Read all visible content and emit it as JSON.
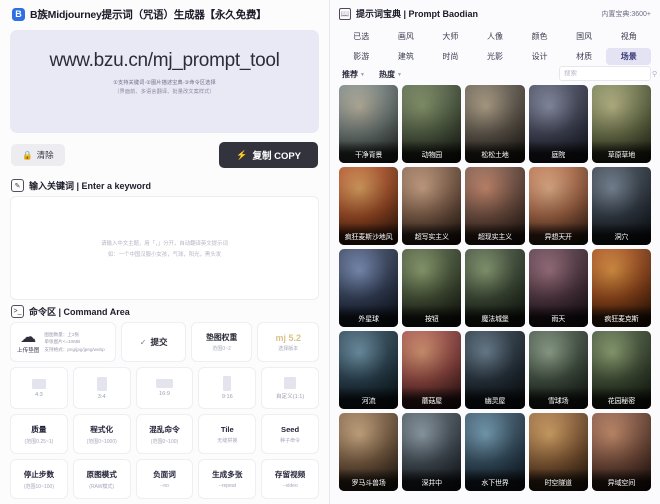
{
  "left": {
    "titlebar": {
      "logo": "B",
      "title": "B族Midjourney提示词（咒语）生成器【永久免费】"
    },
    "hero": {
      "url": "www.bzu.cn/mj_prompt_tool",
      "sub1": "①支持关键词·②图片描述宝典·③命令区选择",
      "sub2": "（界面前、多语言翻译、批量改文案样式）"
    },
    "actions": {
      "clear_label": "清除",
      "clear_icon": "lock-icon",
      "copy_label": "复制 COPY",
      "copy_icon": "lightning-icon"
    },
    "keyword_section": {
      "icon": "note-edit-icon",
      "heading": "输入关键词 | Enter a keyword",
      "placeholder_line1": "请输入中文主题，用「，」分开，自动翻译英文提示词",
      "placeholder_line2": "如：一个中国汉服小女孩，气球，阳光，黑头发"
    },
    "command_section": {
      "icon": "terminal-icon",
      "heading": "命令区 | Command Area",
      "upload": {
        "icon": "cloud-upload-icon",
        "label": "上传垫图",
        "meta": [
          "图图数量：上2张",
          "单张图片<=10MB",
          "支持格式：png/jpg/jpeg/webp"
        ]
      },
      "submit": {
        "icon": "check-circle-icon",
        "label": "提交"
      },
      "weight": {
        "label": "垫图权重",
        "sub": "范围0~2"
      },
      "version": {
        "label": "mj 5.2",
        "sub": "选择版本"
      },
      "ratios": [
        {
          "label": "4:3",
          "w": 14,
          "h": 10
        },
        {
          "label": "3:4",
          "w": 10,
          "h": 14
        },
        {
          "label": "16:9",
          "w": 17,
          "h": 9
        },
        {
          "label": "9:16",
          "w": 8,
          "h": 15
        },
        {
          "label": "自定义(1:1)",
          "w": 12,
          "h": 12
        }
      ],
      "params": [
        {
          "name": "质量",
          "sub": "(范围0.25~1)"
        },
        {
          "name": "程式化",
          "sub": "(范围0~1000)"
        },
        {
          "name": "混乱命令",
          "sub": "(范围0~100)"
        },
        {
          "name": "Tile",
          "sub": "无缝拼接"
        },
        {
          "name": "Seed",
          "sub": "种子命令"
        },
        {
          "name": "停止步数",
          "sub": "(范围10~100)"
        },
        {
          "name": "原图模式",
          "sub": "(RAW模式)"
        },
        {
          "name": "负面词",
          "sub": "--no"
        },
        {
          "name": "生成多张",
          "sub": "--repeat"
        },
        {
          "name": "存留视频",
          "sub": "--video"
        }
      ]
    }
  },
  "right": {
    "header": {
      "icon": "book-icon",
      "title": "提示词宝典 | Prompt Baodian",
      "count": "内置宝典:3600+"
    },
    "categories_row1": [
      "已选",
      "画风",
      "大师",
      "人像",
      "颜色",
      "国风",
      "视角"
    ],
    "categories_row2": [
      "影游",
      "建筑",
      "时尚",
      "光影",
      "设计",
      "材质",
      "场景"
    ],
    "active_category": "场景",
    "sort": {
      "recommend": "推荐",
      "hot": "热度",
      "caret": "chevron-down-icon"
    },
    "search": {
      "placeholder": "搜索",
      "icon": "search-icon"
    },
    "thumbs": [
      {
        "label": "干净背景",
        "c1": "#7d8a86",
        "c2": "#2b3230",
        "c3": "#c2b9a4"
      },
      {
        "label": "动物园",
        "c1": "#5c6b4e",
        "c2": "#1d2318",
        "c3": "#8a9a6a"
      },
      {
        "label": "松松土地",
        "c1": "#6d6457",
        "c2": "#241f1a",
        "c3": "#b9a98c"
      },
      {
        "label": "庭院",
        "c1": "#4a4e63",
        "c2": "#181b28",
        "c3": "#8e93ad"
      },
      {
        "label": "草原草地",
        "c1": "#7d8457",
        "c2": "#2a2e1c",
        "c3": "#c3c08a"
      },
      {
        "label": "疯狂麦斯沙地风",
        "c1": "#b2552a",
        "c2": "#3a1a0c",
        "c3": "#e4a35c"
      },
      {
        "label": "超写实主义",
        "c1": "#8f6a52",
        "c2": "#2c1d15",
        "c3": "#d4a887"
      },
      {
        "label": "超现实主义",
        "c1": "#7f5a4a",
        "c2": "#2a1a14",
        "c3": "#d08a6c"
      },
      {
        "label": "异想天开",
        "c1": "#b9734f",
        "c2": "#3b2014",
        "c3": "#edb489"
      },
      {
        "label": "洞穴",
        "c1": "#3a4450",
        "c2": "#10151c",
        "c3": "#7b8a9c"
      },
      {
        "label": "外星球",
        "c1": "#3c4a66",
        "c2": "#101726",
        "c3": "#7d93c0"
      },
      {
        "label": "按钮",
        "c1": "#4e5c3e",
        "c2": "#161d12",
        "c3": "#8fa46e"
      },
      {
        "label": "魔法城堡",
        "c1": "#46543e",
        "c2": "#141a12",
        "c3": "#8aa071"
      },
      {
        "label": "雨天",
        "c1": "#5b3e4a",
        "c2": "#1c1218",
        "c3": "#a0707f"
      },
      {
        "label": "疯狂麦克斯",
        "c1": "#a8521f",
        "c2": "#36180a",
        "c3": "#e6953c"
      },
      {
        "label": "河流",
        "c1": "#2f4a5a",
        "c2": "#0d1820",
        "c3": "#6e97ad"
      },
      {
        "label": "蘑菇屋",
        "c1": "#a6524a",
        "c2": "#35161a",
        "c3": "#e09a72"
      },
      {
        "label": "幽灵屋",
        "c1": "#2c3a46",
        "c2": "#0c1116",
        "c3": "#6b8294"
      },
      {
        "label": "雪球场",
        "c1": "#4a5a4a",
        "c2": "#161e18",
        "c3": "#93a88f"
      },
      {
        "label": "花园秘密",
        "c1": "#4a5a3e",
        "c2": "#171f14",
        "c3": "#8fa672"
      },
      {
        "label": "罗马斗兽场",
        "c1": "#8a6a4c",
        "c2": "#2c2014",
        "c3": "#d6b184"
      },
      {
        "label": "深井中",
        "c1": "#4e5a64",
        "c2": "#171d22",
        "c3": "#94a4b0"
      },
      {
        "label": "水下世界",
        "c1": "#3d5a6e",
        "c2": "#101c26",
        "c3": "#78a6bf"
      },
      {
        "label": "时空隧道",
        "c1": "#9a6a3e",
        "c2": "#301f10",
        "c3": "#e0a964"
      },
      {
        "label": "异域空间",
        "c1": "#8a5a46",
        "c2": "#2c1812",
        "c3": "#d0906a"
      }
    ]
  }
}
